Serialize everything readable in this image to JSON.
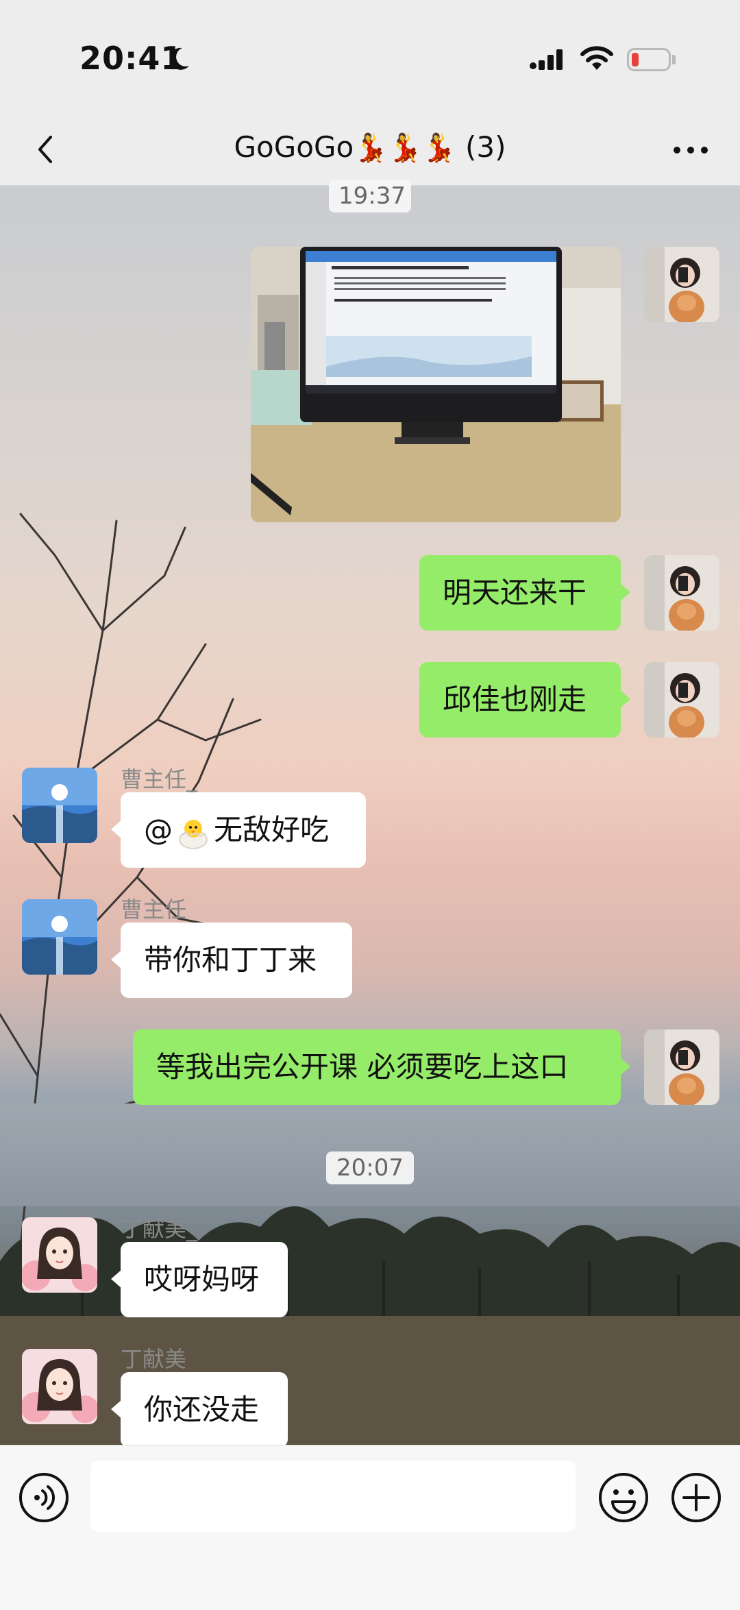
{
  "status_bar": {
    "time": "20:41"
  },
  "header": {
    "title": "GoGoGo",
    "title_emoji": "💃💃💃",
    "member_count": "(3)"
  },
  "messages": {
    "timestamp_1": "19:37",
    "msg_2": "明天还来干",
    "msg_3": "邱佳也刚走",
    "sender_1": "曹主任_",
    "msg_4_prefix": "@",
    "msg_4_text": "无敌好吃",
    "sender_2": "曹主任",
    "msg_5": "带你和丁丁来",
    "msg_6": "等我出完公开课 必须要吃上这口",
    "timestamp_2": "20:07",
    "sender_3": "丁献美_",
    "msg_7": "哎呀妈呀",
    "sender_4": "丁献美",
    "msg_8": "你还没走"
  },
  "colors": {
    "outgoing_bubble": "#95ec69",
    "incoming_bubble": "#ffffff",
    "battery_low": "#e8413a"
  },
  "icons": [
    "back-icon",
    "more-icon",
    "voice-icon",
    "emoji-icon",
    "plus-icon",
    "moon-icon",
    "signal-icon",
    "wifi-icon",
    "battery-icon"
  ]
}
